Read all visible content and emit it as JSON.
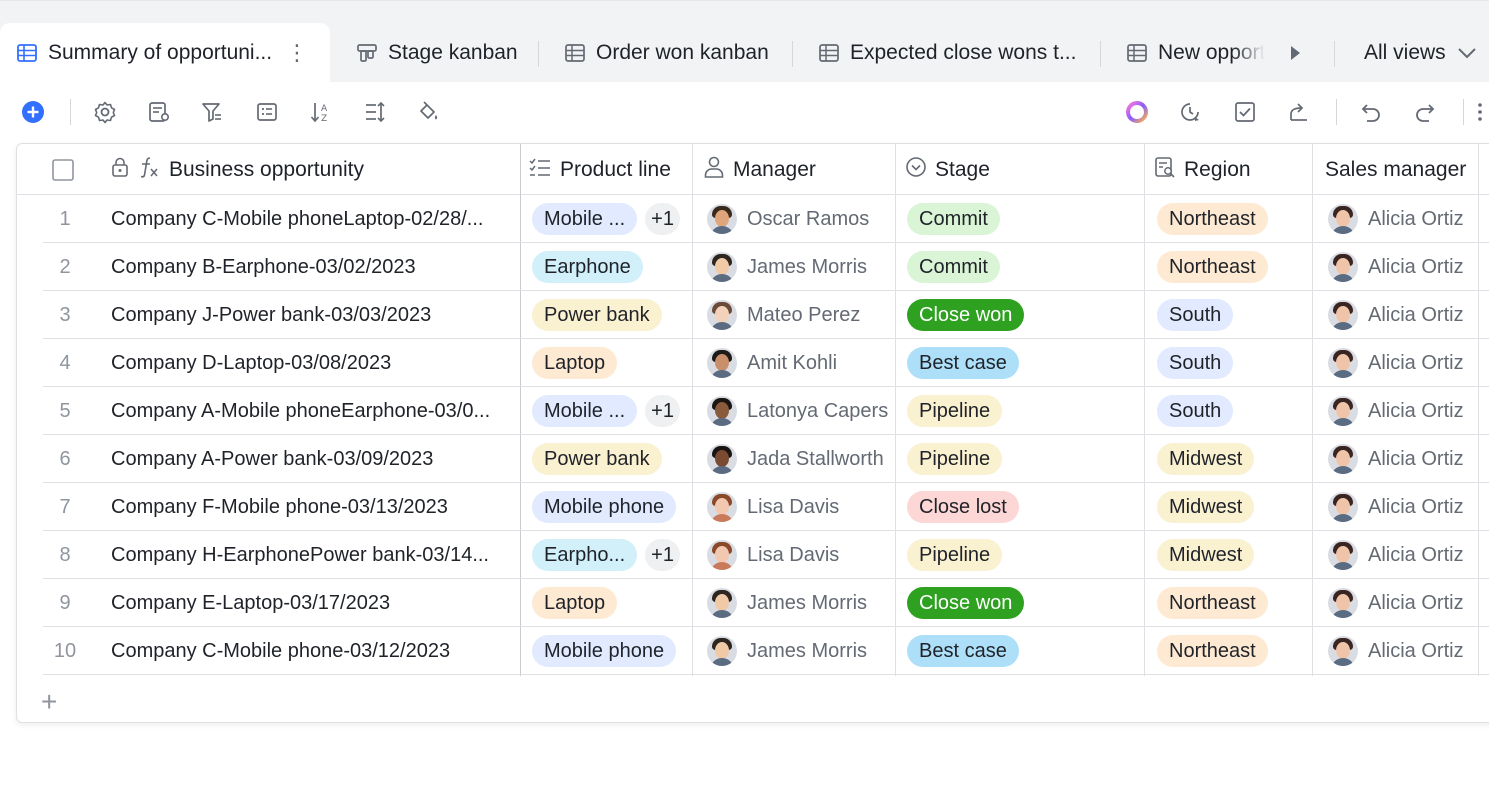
{
  "tabs": [
    {
      "label": "Summary of opportuni...",
      "icon": "grid-table-icon",
      "active": true
    },
    {
      "label": "Stage kanban",
      "icon": "kanban-icon"
    },
    {
      "label": "Order won kanban",
      "icon": "grid-table-icon"
    },
    {
      "label": "Expected close wons t...",
      "icon": "grid-table-icon"
    },
    {
      "label": "New opport",
      "icon": "grid-table-icon"
    }
  ],
  "tab_more": "⋮",
  "all_views_label": "All views",
  "columns": {
    "business_opportunity": "Business opportunity",
    "product_line": "Product line",
    "manager": "Manager",
    "stage": "Stage",
    "region": "Region",
    "sales_manager": "Sales manager"
  },
  "rows": [
    {
      "num": "1",
      "opportunity": "Company C-Mobile phoneLaptop-02/28/...",
      "product": "Mobile ...",
      "product_color": "#e1eaff",
      "extra": "+1",
      "manager": "Oscar Ramos",
      "manager_skin": "#e0a57a",
      "manager_hair": "#3a2a1e",
      "stage": "Commit",
      "stage_bg": "#d9f5d6",
      "stage_fg": "#1f2329",
      "region": "Northeast",
      "region_bg": "#feead2",
      "sales": "Alicia Ortiz"
    },
    {
      "num": "2",
      "opportunity": "Company B-Earphone-03/02/2023",
      "product": "Earphone",
      "product_color": "#d1f0fa",
      "extra": "",
      "manager": "James Morris",
      "manager_skin": "#f0c9a6",
      "manager_hair": "#2d2520",
      "stage": "Commit",
      "stage_bg": "#d9f5d6",
      "stage_fg": "#1f2329",
      "region": "Northeast",
      "region_bg": "#feead2",
      "sales": "Alicia Ortiz"
    },
    {
      "num": "3",
      "opportunity": "Company J-Power bank-03/03/2023",
      "product": "Power bank",
      "product_color": "#faf1d1",
      "extra": "",
      "manager": "Mateo Perez",
      "manager_skin": "#f3d2bc",
      "manager_hair": "#6b4a3a",
      "stage": "Close won",
      "stage_bg": "#2ea121",
      "stage_fg": "#ffffff",
      "region": "South",
      "region_bg": "#e1eaff",
      "sales": "Alicia Ortiz"
    },
    {
      "num": "4",
      "opportunity": "Company D-Laptop-03/08/2023",
      "product": "Laptop",
      "product_color": "#feead2",
      "extra": "",
      "manager": "Amit Kohli",
      "manager_skin": "#c98f6a",
      "manager_hair": "#1e1a18",
      "stage": "Best case",
      "stage_bg": "#aedff8",
      "stage_fg": "#1f2329",
      "region": "South",
      "region_bg": "#e1eaff",
      "sales": "Alicia Ortiz"
    },
    {
      "num": "5",
      "opportunity": "Company A-Mobile phoneEarphone-03/0...",
      "product": "Mobile ...",
      "product_color": "#e1eaff",
      "extra": "+1",
      "manager": "Latonya Capers",
      "manager_skin": "#8a5a3c",
      "manager_hair": "#1a1412",
      "stage": "Pipeline",
      "stage_bg": "#faf1d1",
      "stage_fg": "#1f2329",
      "region": "South",
      "region_bg": "#e1eaff",
      "sales": "Alicia Ortiz"
    },
    {
      "num": "6",
      "opportunity": "Company A-Power bank-03/09/2023",
      "product": "Power bank",
      "product_color": "#faf1d1",
      "extra": "",
      "manager": "Jada Stallworth",
      "manager_skin": "#7a4a32",
      "manager_hair": "#1a1412",
      "stage": "Pipeline",
      "stage_bg": "#faf1d1",
      "stage_fg": "#1f2329",
      "region": "Midwest",
      "region_bg": "#faf1d1",
      "sales": "Alicia Ortiz"
    },
    {
      "num": "7",
      "opportunity": "Company F-Mobile phone-03/13/2023",
      "product": "Mobile phone",
      "product_color": "#e1eaff",
      "extra": "",
      "manager": "Lisa Davis",
      "manager_skin": "#f2c9b0",
      "manager_hair": "#8a4a2a",
      "stage": "Close lost",
      "stage_bg": "#fdd6d6",
      "stage_fg": "#1f2329",
      "region": "Midwest",
      "region_bg": "#faf1d1",
      "sales": "Alicia Ortiz"
    },
    {
      "num": "8",
      "opportunity": "Company H-EarphonePower bank-03/14...",
      "product": "Earpho...",
      "product_color": "#d1f0fa",
      "extra": "+1",
      "manager": "Lisa Davis",
      "manager_skin": "#f2c9b0",
      "manager_hair": "#8a4a2a",
      "stage": "Pipeline",
      "stage_bg": "#faf1d1",
      "stage_fg": "#1f2329",
      "region": "Midwest",
      "region_bg": "#faf1d1",
      "sales": "Alicia Ortiz"
    },
    {
      "num": "9",
      "opportunity": "Company E-Laptop-03/17/2023",
      "product": "Laptop",
      "product_color": "#feead2",
      "extra": "",
      "manager": "James Morris",
      "manager_skin": "#f0c9a6",
      "manager_hair": "#2d2520",
      "stage": "Close won",
      "stage_bg": "#2ea121",
      "stage_fg": "#ffffff",
      "region": "Northeast",
      "region_bg": "#feead2",
      "sales": "Alicia Ortiz"
    },
    {
      "num": "10",
      "opportunity": "Company C-Mobile phone-03/12/2023",
      "product": "Mobile phone",
      "product_color": "#e1eaff",
      "extra": "",
      "manager": "James Morris",
      "manager_skin": "#f0c9a6",
      "manager_hair": "#2d2520",
      "stage": "Best case",
      "stage_bg": "#aedff8",
      "stage_fg": "#1f2329",
      "region": "Northeast",
      "region_bg": "#feead2",
      "sales": "Alicia Ortiz"
    }
  ],
  "add_row_label": "+",
  "colors": {
    "accent": "#3370ff",
    "tabbar_bg": "#f2f3f5",
    "text": "#1f2329",
    "muted": "#646a73"
  }
}
